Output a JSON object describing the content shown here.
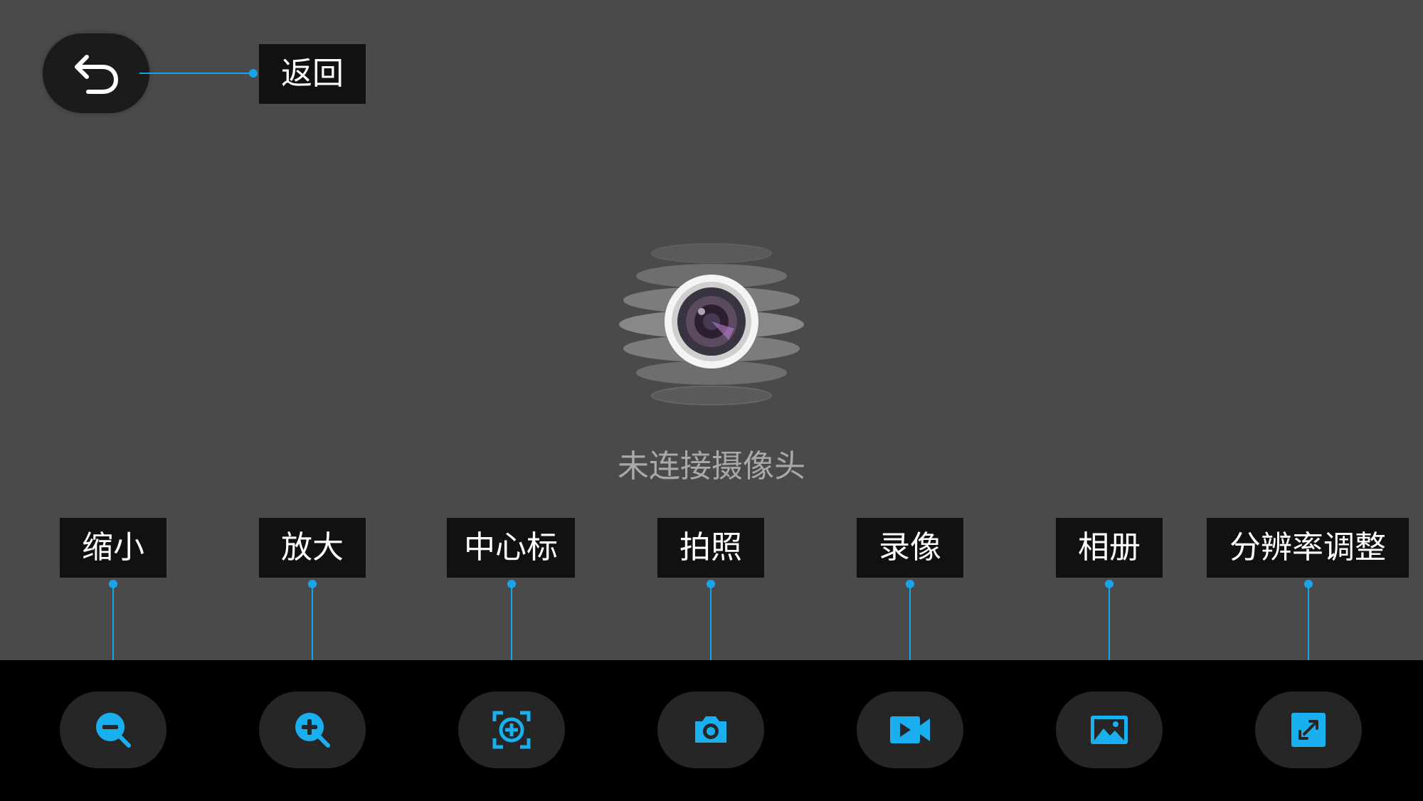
{
  "back": {
    "label": "返回",
    "icon": "back-arrow-icon"
  },
  "camera": {
    "status": "未连接摄像头",
    "icon": "camera-lens-icon"
  },
  "toolbar": [
    {
      "id": "zoom-out",
      "label": "缩小",
      "icon": "zoom-out-icon"
    },
    {
      "id": "zoom-in",
      "label": "放大",
      "icon": "zoom-in-icon"
    },
    {
      "id": "center",
      "label": "中心标",
      "icon": "center-mark-icon"
    },
    {
      "id": "photo",
      "label": "拍照",
      "icon": "camera-icon"
    },
    {
      "id": "record",
      "label": "录像",
      "icon": "video-icon"
    },
    {
      "id": "album",
      "label": "相册",
      "icon": "gallery-icon"
    },
    {
      "id": "resolution",
      "label": "分辨率调整",
      "icon": "resize-icon"
    }
  ],
  "colors": {
    "accent": "#17a4e8",
    "icon": "#1ab0f0",
    "background": "#4a4a4a",
    "toolbar": "#000000",
    "label_bg": "#111111",
    "status_text": "#a9a9a9"
  }
}
